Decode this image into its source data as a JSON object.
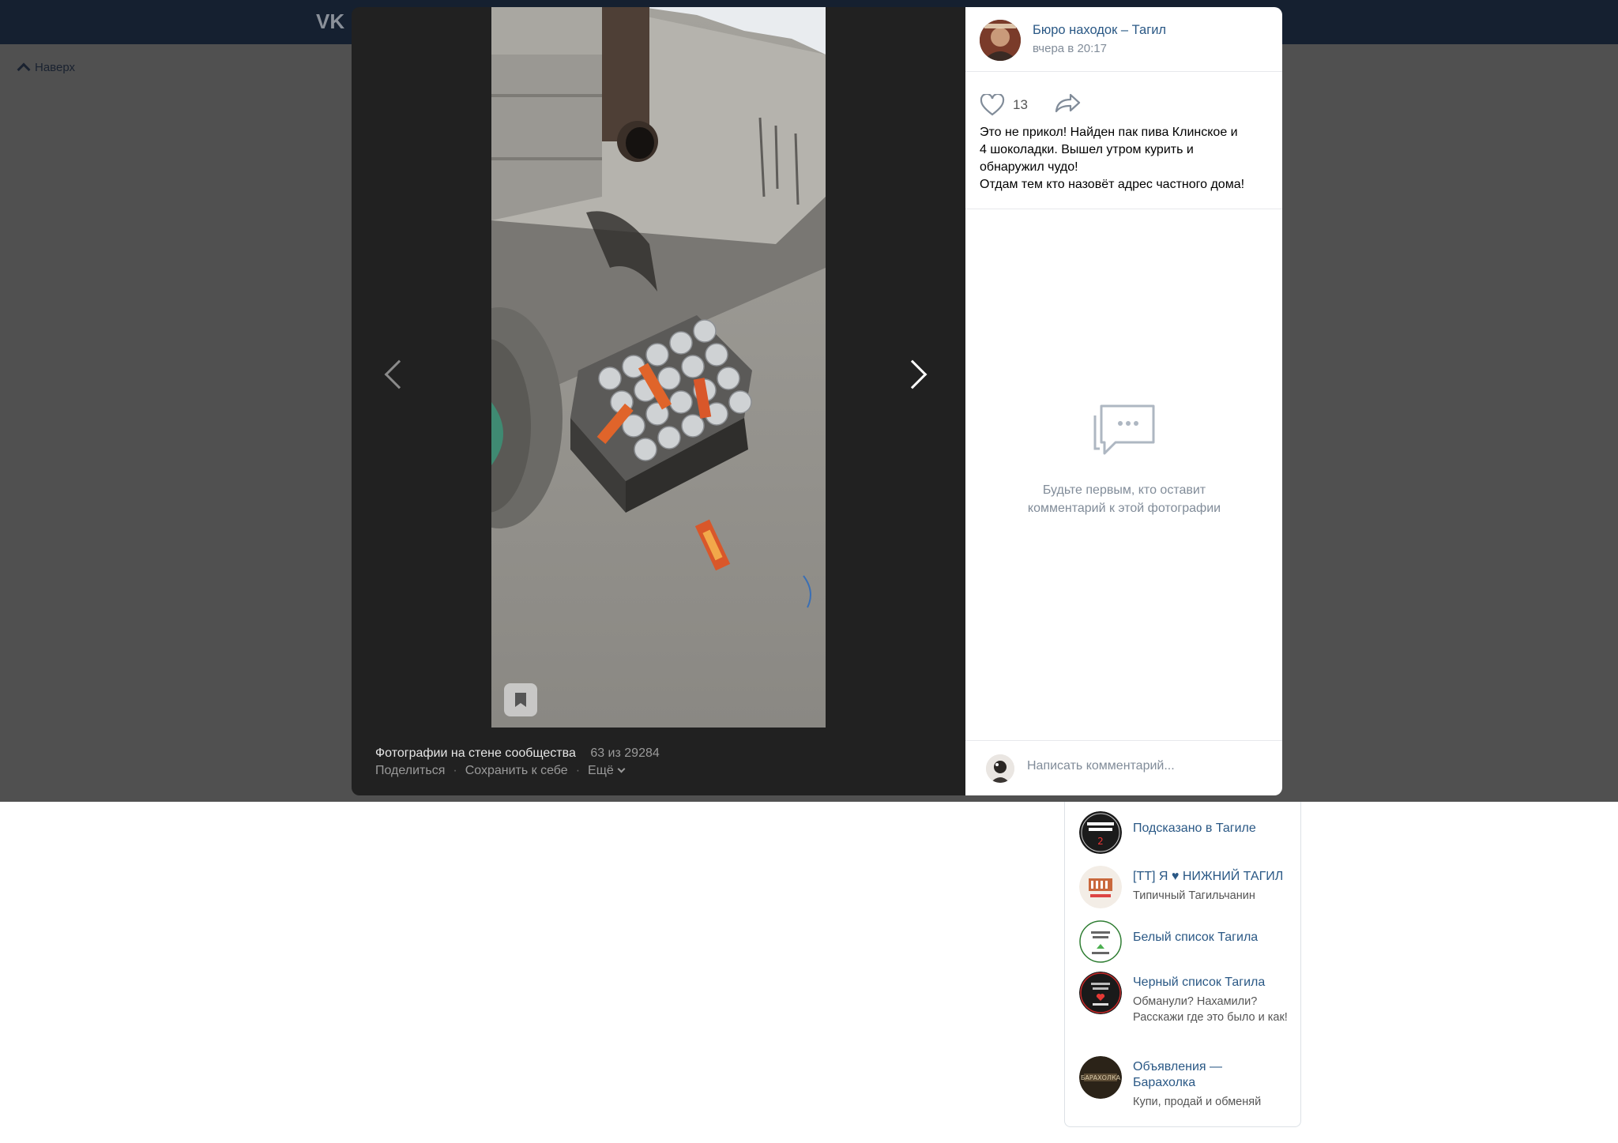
{
  "nav": {
    "back_label": "Наверх"
  },
  "viewer": {
    "album_title": "Фотографии на стене сообщества",
    "counter": "63 из 29284",
    "actions": {
      "share": "Поделиться",
      "save": "Сохранить к себе",
      "more": "Ещё"
    }
  },
  "post": {
    "author": "Бюро находок – Тагил",
    "time": "вчера в 20:17",
    "likes": "13",
    "text_lines": [
      "Это не прикол! Найден пак пива Клинское и",
      "4 шоколадки. Вышел утром курить и",
      "обнаружил чудо!",
      "Отдам тем кто назовёт адрес частного дома!"
    ],
    "empty_comments": "Будьте первым, кто оставит комментарий к этой фотографии",
    "comment_placeholder": "Написать комментарий..."
  },
  "sidebar": {
    "items": [
      {
        "title": "Подсказано в Тагиле",
        "subtitle": ""
      },
      {
        "title": "[ТТ] Я ♥ НИЖНИЙ ТАГИЛ",
        "subtitle": "Типичный Тагильчанин"
      },
      {
        "title": "Белый список Тагила",
        "subtitle": ""
      },
      {
        "title": "Черный список Тагила",
        "subtitle": "Обманули? Нахамили? Расскажи где это было и как!"
      },
      {
        "title": "Объявления — Барахолка",
        "subtitle": "Купи, продай и обменяй"
      }
    ]
  },
  "colors": {
    "link": "#2a5885",
    "muted": "#818c99",
    "viewer_bg": "#212121",
    "topbar": "#152030"
  },
  "icons": [
    "vk-logo",
    "heart-icon",
    "share-icon",
    "chevron-left-icon",
    "chevron-right-icon",
    "bookmark-icon",
    "comments-empty-icon",
    "chevron-down-icon",
    "chevron-up-icon"
  ]
}
